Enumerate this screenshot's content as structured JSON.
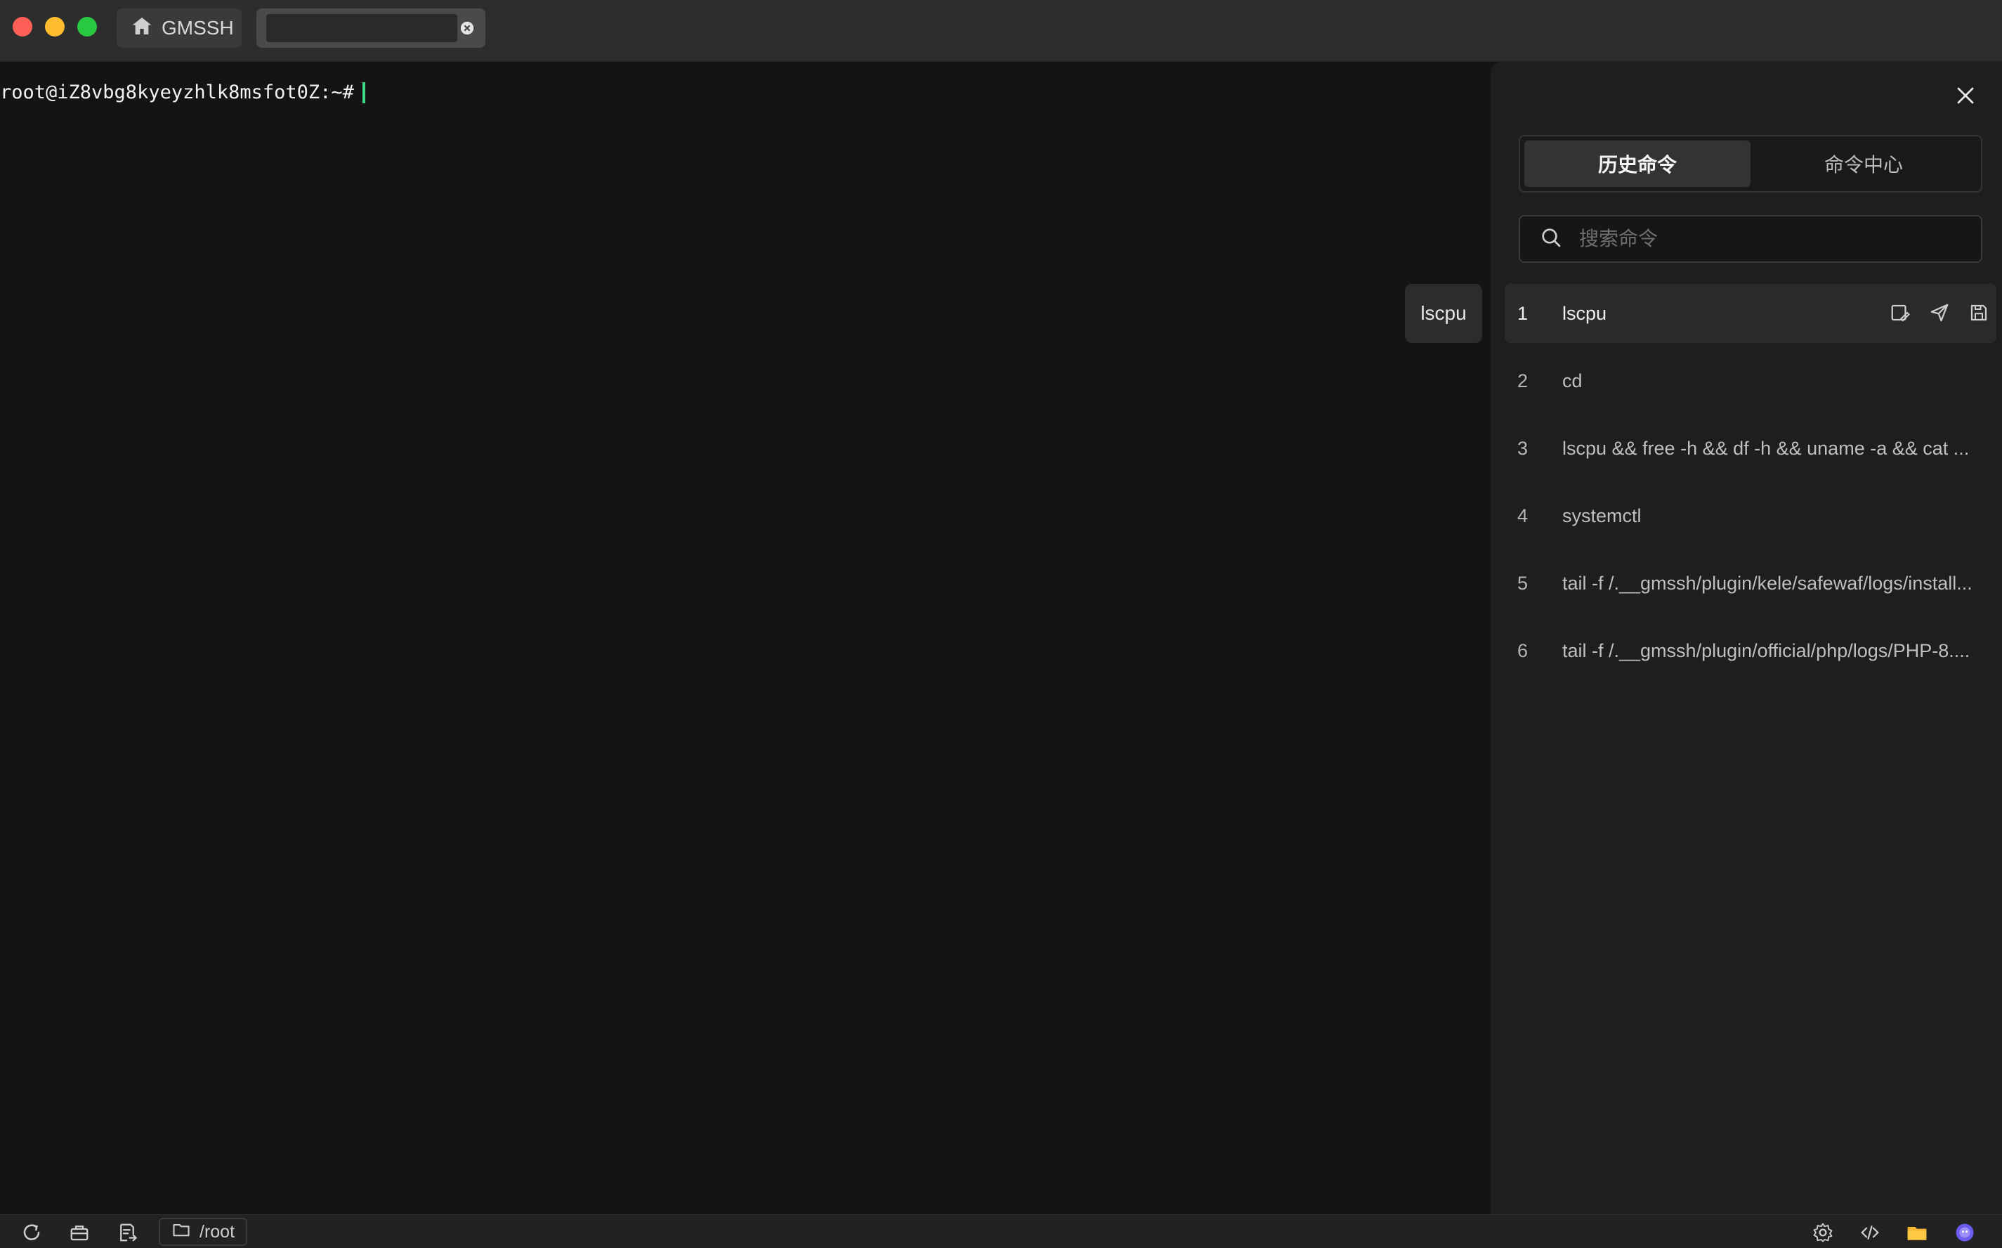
{
  "titlebar": {
    "home_tab_label": "GMSSH"
  },
  "terminal": {
    "prompt": "root@iZ8vbg8kyeyzhlk8msfot0Z:~#"
  },
  "tooltip": {
    "text": "lscpu"
  },
  "panel": {
    "tabs": [
      {
        "label": "历史命令",
        "active": true
      },
      {
        "label": "命令中心",
        "active": false
      }
    ],
    "search": {
      "placeholder": "搜索命令",
      "value": ""
    },
    "history": [
      {
        "num": "1",
        "cmd": "lscpu"
      },
      {
        "num": "2",
        "cmd": "cd"
      },
      {
        "num": "3",
        "cmd": "lscpu && free -h && df -h && uname -a && cat ..."
      },
      {
        "num": "4",
        "cmd": "systemctl"
      },
      {
        "num": "5",
        "cmd": "tail -f /.__gmssh/plugin/kele/safewaf/logs/install..."
      },
      {
        "num": "6",
        "cmd": "tail -f /.__gmssh/plugin/official/php/logs/PHP-8...."
      }
    ]
  },
  "bottombar": {
    "path": "/root"
  },
  "colors": {
    "cursor": "#3ddc84",
    "panel_bg": "#1e1e1e",
    "terminal_bg": "#141414"
  }
}
